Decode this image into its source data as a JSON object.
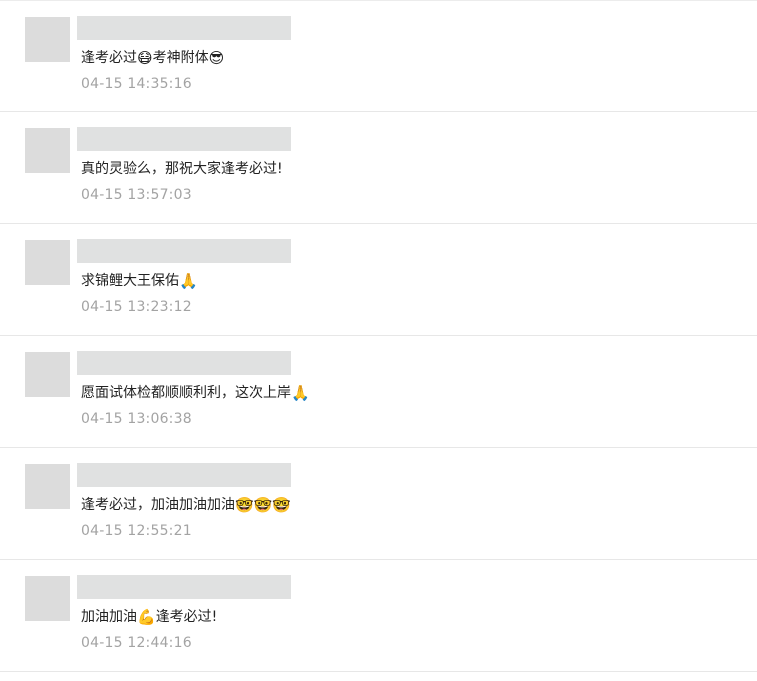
{
  "comments": [
    {
      "parts": [
        {
          "t": "text",
          "v": "逢考必过"
        },
        {
          "t": "emoji",
          "v": "😷",
          "icon": "exam-blessing-emoji-icon"
        },
        {
          "t": "text",
          "v": "考神附体"
        },
        {
          "t": "emoji",
          "v": "😎",
          "icon": "cool-face-emoji-icon"
        }
      ],
      "time": "04-15 14:35:16"
    },
    {
      "parts": [
        {
          "t": "text",
          "v": "真的灵验么，那祝大家逢考必过!"
        }
      ],
      "time": "04-15 13:57:03"
    },
    {
      "parts": [
        {
          "t": "text",
          "v": "求锦鲤大王保佑"
        },
        {
          "t": "emoji",
          "v": "🙏",
          "icon": "praying-hands-emoji-icon"
        }
      ],
      "time": "04-15 13:23:12"
    },
    {
      "parts": [
        {
          "t": "text",
          "v": "愿面试体检都顺顺利利，这次上岸"
        },
        {
          "t": "emoji",
          "v": "🙏",
          "icon": "praying-hands-emoji-icon"
        }
      ],
      "time": "04-15 13:06:38"
    },
    {
      "parts": [
        {
          "t": "text",
          "v": "逢考必过，加油加油加油"
        },
        {
          "t": "emoji",
          "v": "🤓",
          "icon": "determined-face-emoji-icon"
        },
        {
          "t": "emoji",
          "v": "🤓",
          "icon": "determined-face-emoji-icon"
        },
        {
          "t": "emoji",
          "v": "🤓",
          "icon": "determined-face-emoji-icon"
        }
      ],
      "time": "04-15 12:55:21"
    },
    {
      "parts": [
        {
          "t": "text",
          "v": "加油加油"
        },
        {
          "t": "emoji",
          "v": "💪",
          "icon": "flexed-bicep-emoji-icon"
        },
        {
          "t": "text",
          "v": "逢考必过!"
        }
      ],
      "time": "04-15 12:44:16"
    }
  ]
}
